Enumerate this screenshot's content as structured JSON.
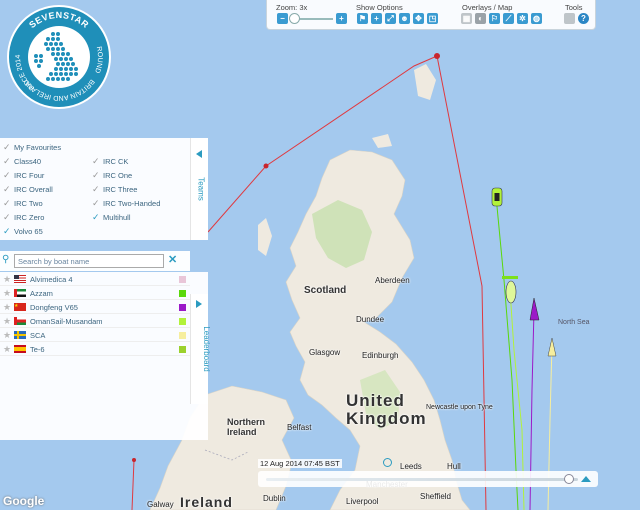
{
  "toolbar": {
    "zoom_label": "Zoom: 3x",
    "zoom_level": 3,
    "zoom_minus": "−",
    "zoom_plus": "+",
    "show_options_label": "Show Options",
    "overlays_label": "Overlays / Map",
    "tools_label": "Tools",
    "help_glyph": "?"
  },
  "logo": {
    "text_top": "SEVENSTAR",
    "text_left": "RACE 2014",
    "text_bottom": "BRITAIN AND IRELAND",
    "text_right": "ROUND"
  },
  "teams": {
    "tab_label": "Teams",
    "items": [
      {
        "label": "My Favourites",
        "checked": false
      },
      {
        "label": "Class40",
        "checked": false
      },
      {
        "label": "IRC CK",
        "checked": false
      },
      {
        "label": "IRC Four",
        "checked": false
      },
      {
        "label": "IRC One",
        "checked": false
      },
      {
        "label": "IRC Overall",
        "checked": false
      },
      {
        "label": "IRC Three",
        "checked": false
      },
      {
        "label": "IRC Two",
        "checked": false
      },
      {
        "label": "IRC Two-Handed",
        "checked": false
      },
      {
        "label": "IRC Zero",
        "checked": false
      },
      {
        "label": "Multihull",
        "checked": true
      },
      {
        "label": "Volvo 65",
        "checked": true
      }
    ]
  },
  "search": {
    "placeholder": "Search by boat name",
    "value": "",
    "clear_glyph": "✕"
  },
  "leaderboard": {
    "tab_label": "Leaderboard",
    "rows": [
      {
        "name": "Alvimedica 4",
        "flag": "us",
        "color": "#e9c6d8"
      },
      {
        "name": "Azzam",
        "flag": "ae",
        "color": "#5ad80a"
      },
      {
        "name": "Dongfeng V65",
        "flag": "cn",
        "color": "#9b19c8"
      },
      {
        "name": "OmanSail-Musandam",
        "flag": "om",
        "color": "#b2f23a"
      },
      {
        "name": "SCA",
        "flag": "se",
        "color": "#f6ee9e"
      },
      {
        "name": "Te-6",
        "flag": "es",
        "color": "#9bd12d"
      }
    ]
  },
  "timeline": {
    "datetime": "12 Aug 2014 07:45 BST",
    "position": 0.97
  },
  "map": {
    "attribution": "Google",
    "labels": {
      "uk": "United",
      "uk2": "Kingdom",
      "scotland": "Scotland",
      "ni": "Northern",
      "ni2": "Ireland",
      "ireland": "Ireland",
      "north_sea": "North Sea",
      "aberdeen": "Aberdeen",
      "dundee": "Dundee",
      "glasgow": "Glasgow",
      "edinburgh": "Edinburgh",
      "newcastle": "Newcastle upon Tyne",
      "belfast": "Belfast",
      "leeds": "Leeds",
      "manchester": "Manchester",
      "liverpool": "Liverpool",
      "dublin": "Dublin",
      "sheffield": "Sheffield",
      "hull": "Hull",
      "galway": "Galway"
    }
  }
}
